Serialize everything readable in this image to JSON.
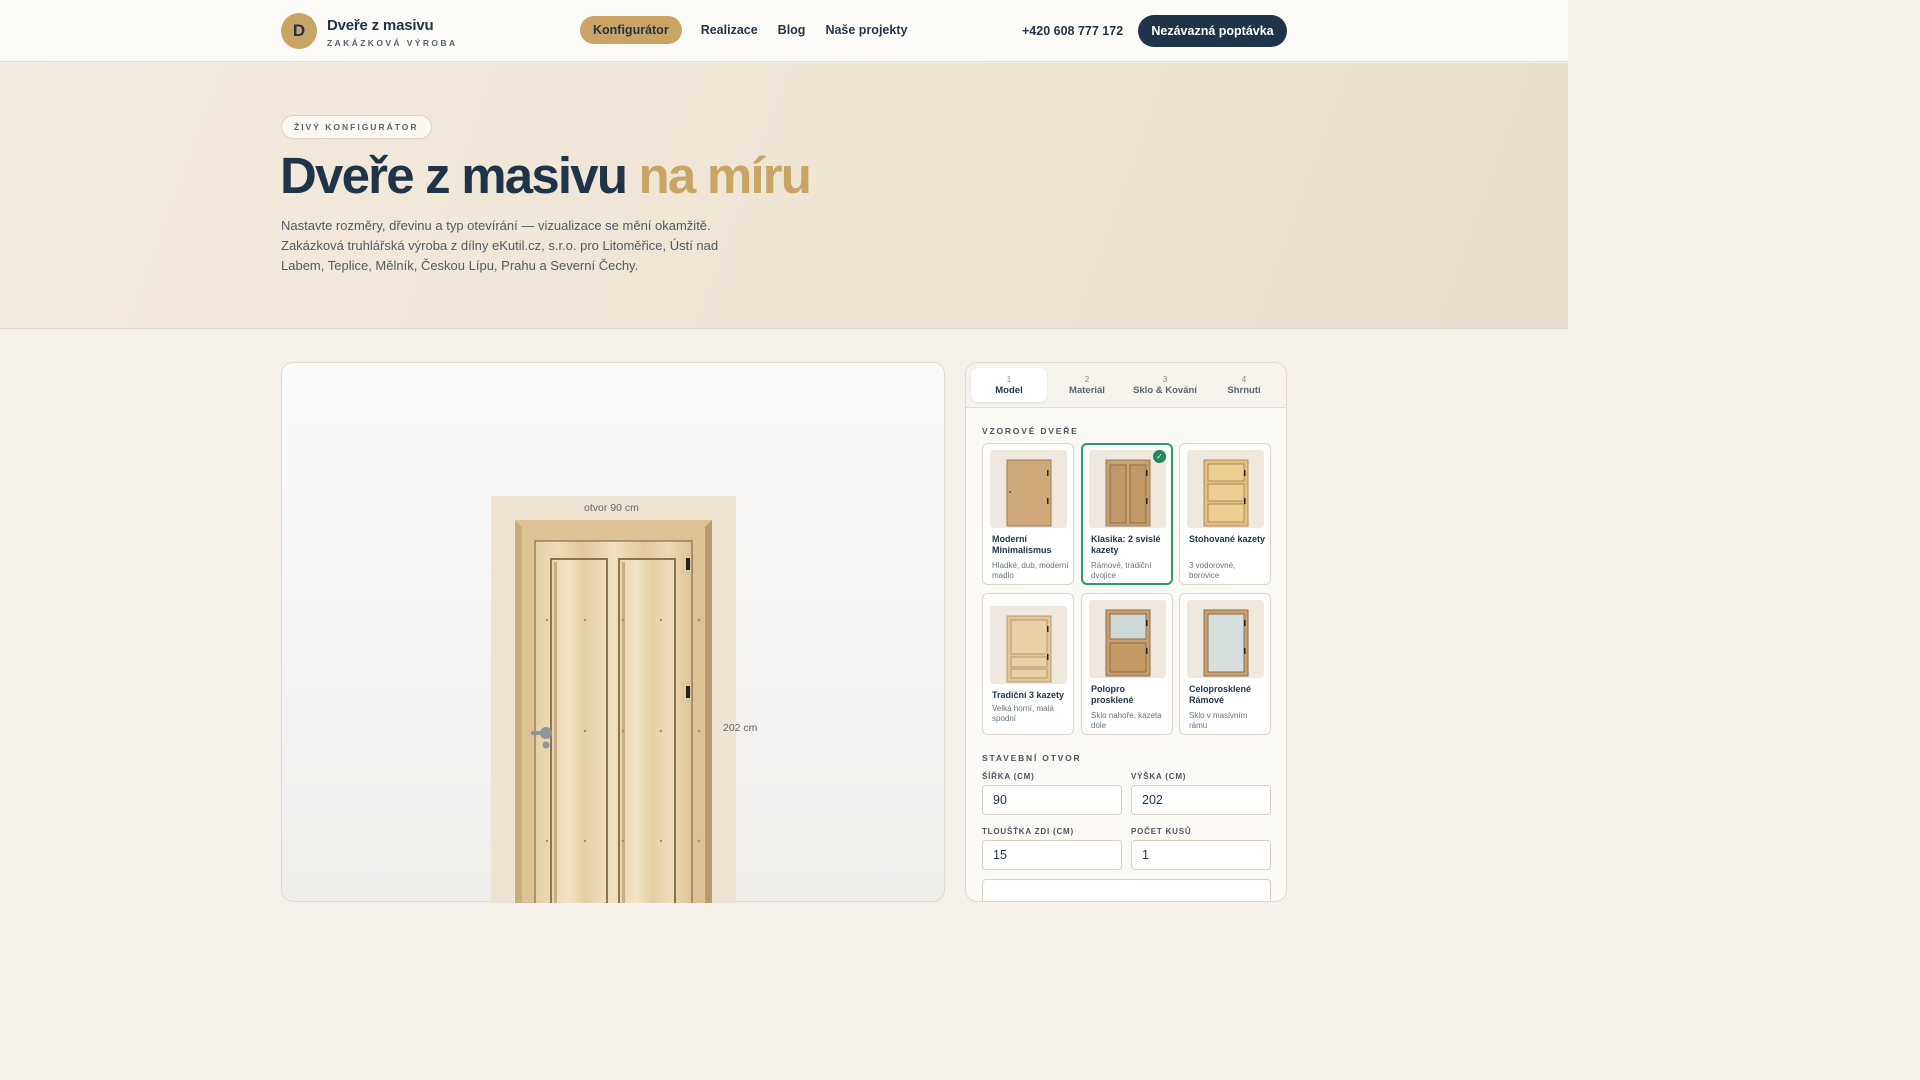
{
  "header": {
    "logo_letter": "D",
    "brand": "Dveře z masivu",
    "tagline": "ZAKÁZKOVÁ VÝROBA",
    "nav": [
      {
        "label": "Konfigurátor",
        "active": true
      },
      {
        "label": "Realizace",
        "active": false
      },
      {
        "label": "Blog",
        "active": false
      },
      {
        "label": "Naše projekty",
        "active": false
      }
    ],
    "phone": "+420 608 777 172",
    "cta": "Nezávazná poptávka"
  },
  "hero": {
    "badge": "ŽIVÝ KONFIGURÁTOR",
    "title_main": "Dveře z masivu",
    "title_accent": "na míru",
    "lead": "Nastavte rozměry, dřevinu a typ otevírání — vizualizace se mění okamžitě. Zakázková truhlářská výroba z dílny eKutil.cz, s.r.o. pro Litoměřice, Ústí nad Labem, Teplice, Mělník, Českou Lípu, Prahu a Severní Čechy."
  },
  "preview": {
    "width_label": "otvor 90 cm",
    "height_label": "202 cm"
  },
  "configurator": {
    "tabs": [
      {
        "num": "1",
        "label": "Model",
        "active": true
      },
      {
        "num": "2",
        "label": "Materiál",
        "active": false
      },
      {
        "num": "3",
        "label": "Sklo & Kování",
        "active": false
      },
      {
        "num": "4",
        "label": "Shrnutí",
        "active": false
      }
    ],
    "models_heading": "VZOROVÉ DVEŘE",
    "models": [
      {
        "title": "Moderní Minimalismus",
        "desc": "Hladké, dub, moderní madlo",
        "selected": false
      },
      {
        "title": "Klasika: 2 svislé kazety",
        "desc": "Rámové, tradiční dvojice",
        "selected": true
      },
      {
        "title": "Stohované kazety",
        "desc": "3 vodorovné, borovice",
        "selected": false
      },
      {
        "title": "Tradiční 3 kazety",
        "desc": "Velká horní, malá spodní",
        "selected": false
      },
      {
        "title": "Polopro prosklené",
        "desc": "Sklo nahoře, kazeta dole",
        "selected": false
      },
      {
        "title": "Celoprosklené Rámové",
        "desc": "Sklo v masivním rámu",
        "selected": false
      }
    ],
    "opening_heading": "STAVEBNÍ OTVOR",
    "fields": {
      "width_label": "ŠÍŘKA (CM)",
      "width_value": "90",
      "height_label": "VÝŠKA (CM)",
      "height_value": "202",
      "wall_label": "TLOUŠŤKA ZDI (CM)",
      "wall_value": "15",
      "count_label": "POČET KUSŮ",
      "count_value": "1"
    }
  }
}
